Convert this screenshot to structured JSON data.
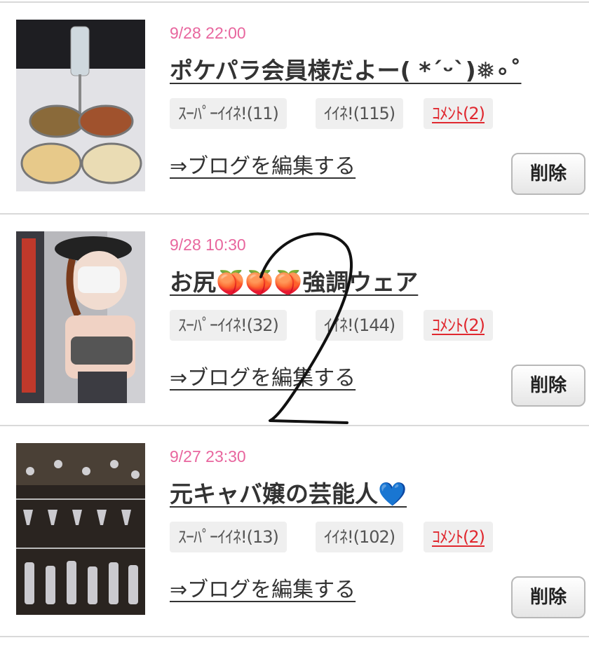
{
  "posts": [
    {
      "date": "9/28 22:00",
      "title": "ポケパラ会員様だよー( *´ᵕ`)❅∘˚",
      "super_like": "ｽｰﾊﾟｰｲｲﾈ!(11)",
      "like": "ｲｲﾈ!(115)",
      "comment": "ｺﾒﾝﾄ(2)",
      "edit_link": "⇒ブログを編集する",
      "delete_label": "削除",
      "thumbnail": "nuts-and-champagne-photo"
    },
    {
      "date": "9/28 10:30",
      "title": "お尻🍑🍑🍑強調ウェア",
      "super_like": "ｽｰﾊﾟｰｲｲﾈ!(32)",
      "like": "ｲｲﾈ!(144)",
      "comment": "ｺﾒﾝﾄ(2)",
      "edit_link": "⇒ブログを編集する",
      "delete_label": "削除",
      "thumbnail": "woman-in-sportswear-photo"
    },
    {
      "date": "9/27 23:30",
      "title": "元キャバ嬢の芸能人💙",
      "super_like": "ｽｰﾊﾟｰｲｲﾈ!(13)",
      "like": "ｲｲﾈ!(102)",
      "comment": "ｺﾒﾝﾄ(2)",
      "edit_link": "⇒ブログを編集する",
      "delete_label": "削除",
      "thumbnail": "glass-shelf-photo"
    }
  ],
  "colors": {
    "date": "#e8669e",
    "comment": "#e0282f",
    "pill_bg": "#efefef",
    "annotation_stroke": "#111111"
  }
}
